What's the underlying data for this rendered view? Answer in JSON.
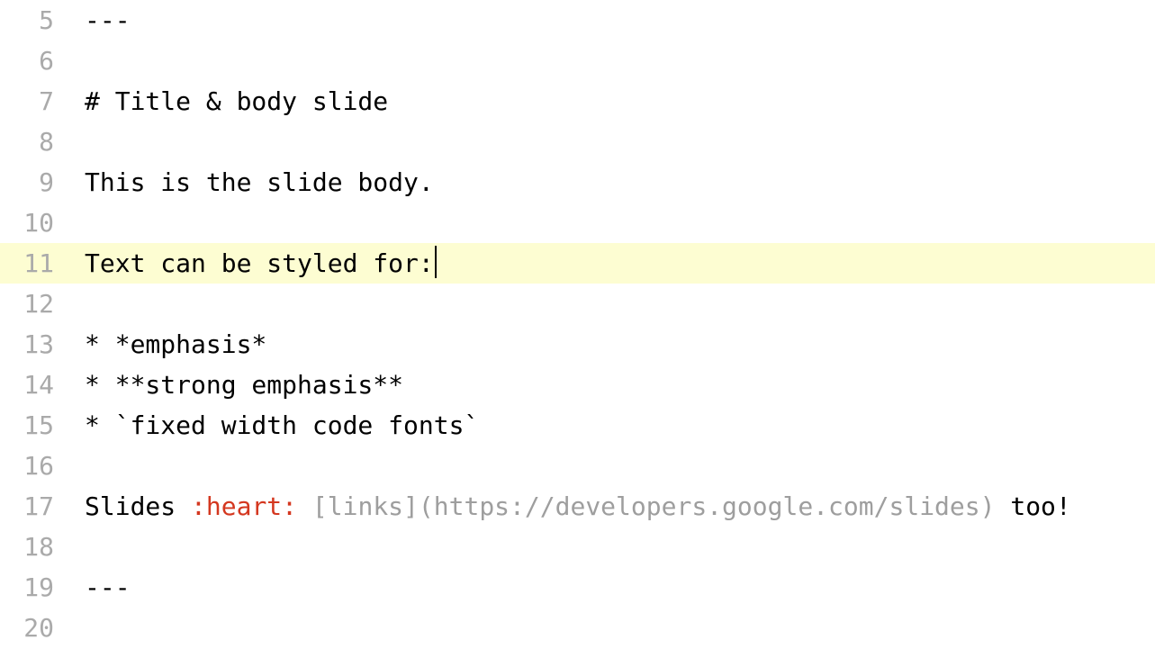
{
  "editor": {
    "startLine": 5,
    "highlightedLine": 11,
    "lines": [
      {
        "num": 5,
        "segments": [
          {
            "text": "---",
            "cls": ""
          }
        ]
      },
      {
        "num": 6,
        "segments": []
      },
      {
        "num": 7,
        "segments": [
          {
            "text": "# Title & body slide",
            "cls": ""
          }
        ]
      },
      {
        "num": 8,
        "segments": []
      },
      {
        "num": 9,
        "segments": [
          {
            "text": "This is the slide body.",
            "cls": ""
          }
        ]
      },
      {
        "num": 10,
        "segments": []
      },
      {
        "num": 11,
        "segments": [
          {
            "text": "Text can be styled for:",
            "cls": ""
          }
        ],
        "cursor": true
      },
      {
        "num": 12,
        "segments": []
      },
      {
        "num": 13,
        "segments": [
          {
            "text": "* *emphasis*",
            "cls": ""
          }
        ]
      },
      {
        "num": 14,
        "segments": [
          {
            "text": "* **strong emphasis**",
            "cls": ""
          }
        ]
      },
      {
        "num": 15,
        "segments": [
          {
            "text": "* `fixed width code fonts`",
            "cls": ""
          }
        ]
      },
      {
        "num": 16,
        "segments": []
      },
      {
        "num": 17,
        "segments": [
          {
            "text": "Slides ",
            "cls": ""
          },
          {
            "text": ":heart:",
            "cls": "tok-emoji"
          },
          {
            "text": " ",
            "cls": ""
          },
          {
            "text": "[links](https://developers.google.com/slides)",
            "cls": "tok-link"
          },
          {
            "text": " too!",
            "cls": ""
          }
        ]
      },
      {
        "num": 18,
        "segments": []
      },
      {
        "num": 19,
        "segments": [
          {
            "text": "---",
            "cls": ""
          }
        ]
      },
      {
        "num": 20,
        "segments": []
      }
    ]
  }
}
